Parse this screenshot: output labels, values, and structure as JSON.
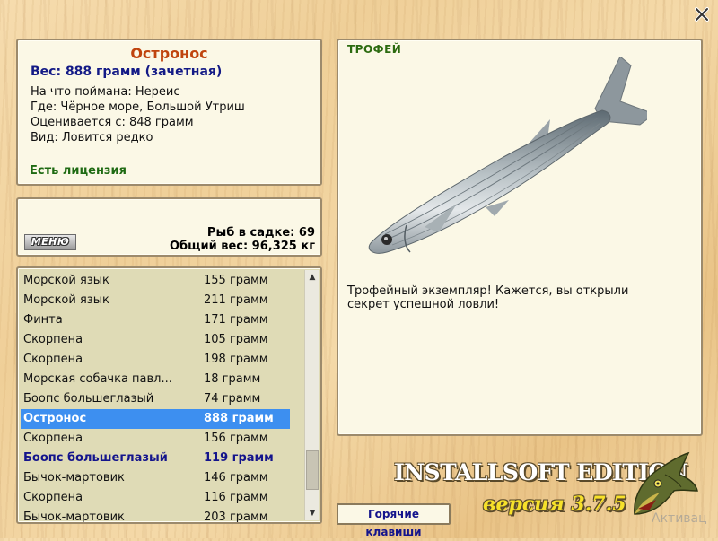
{
  "info": {
    "title": "Остронос",
    "weight": "Вес: 888 грамм (зачетная)",
    "lines": [
      "На что поймана: Нереис",
      "Где: Чёрное море, Большой Утриш",
      "Оценивается с: 848 грамм",
      "Вид: Ловится редко"
    ],
    "license": "Есть лицензия"
  },
  "stats": {
    "menu_label": "МЕНЮ",
    "fish_count": "Рыб в садке: 69",
    "total_weight": "Общий вес: 96,325 кг"
  },
  "fish_list": [
    {
      "name": "Морской язык",
      "weight": "155 грамм",
      "state": ""
    },
    {
      "name": "Морской язык",
      "weight": "211 грамм",
      "state": ""
    },
    {
      "name": "Финта",
      "weight": "171 грамм",
      "state": ""
    },
    {
      "name": "Скорпена",
      "weight": "105 грамм",
      "state": ""
    },
    {
      "name": "Скорпена",
      "weight": "198 грамм",
      "state": ""
    },
    {
      "name": "Морская собачка павл...",
      "weight": "18 грамм",
      "state": ""
    },
    {
      "name": "Боопс большеглазый",
      "weight": "74 грамм",
      "state": ""
    },
    {
      "name": "Остронос",
      "weight": "888 грамм",
      "state": "selected"
    },
    {
      "name": "Скорпена",
      "weight": "156 грамм",
      "state": ""
    },
    {
      "name": "Боопс большеглазый",
      "weight": "119 грамм",
      "state": "highlighted"
    },
    {
      "name": "Бычок-мартовик",
      "weight": "146 грамм",
      "state": ""
    },
    {
      "name": "Скорпена",
      "weight": "116 грамм",
      "state": ""
    },
    {
      "name": "Бычок-мартовик",
      "weight": "203 грамм",
      "state": ""
    }
  ],
  "trophy": {
    "label": "ТРОФЕЙ",
    "message": "Трофейный экземпляр! Кажется, вы открыли секрет успешной ловли!"
  },
  "footer": {
    "hotkeys_label": "Горячие клавиши",
    "edition": "INSTALLSOFT EDITION",
    "version": "версия 3.7.5",
    "activate": "Активац"
  },
  "colors": {
    "title": "#c0440e",
    "weight": "#131a86",
    "license": "#1e6a12",
    "selected_row": "#3d8ff0",
    "version": "#f7e12a"
  }
}
